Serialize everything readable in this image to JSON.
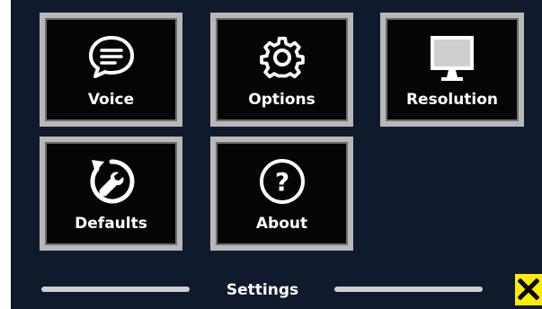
{
  "tiles": {
    "voice": {
      "label": "Voice",
      "icon": "speech-bubble-icon"
    },
    "options": {
      "label": "Options",
      "icon": "gear-icon"
    },
    "resolution": {
      "label": "Resolution",
      "icon": "monitor-icon"
    },
    "defaults": {
      "label": "Defaults",
      "icon": "reset-wrench-icon"
    },
    "about": {
      "label": "About",
      "icon": "question-icon"
    }
  },
  "footer": {
    "title": "Settings",
    "close_icon": "close-icon"
  },
  "colors": {
    "background": "#0f1a2c",
    "tile_background": "#050505",
    "tile_border": "#b8b8b8",
    "close_button": "#ffeb00"
  }
}
